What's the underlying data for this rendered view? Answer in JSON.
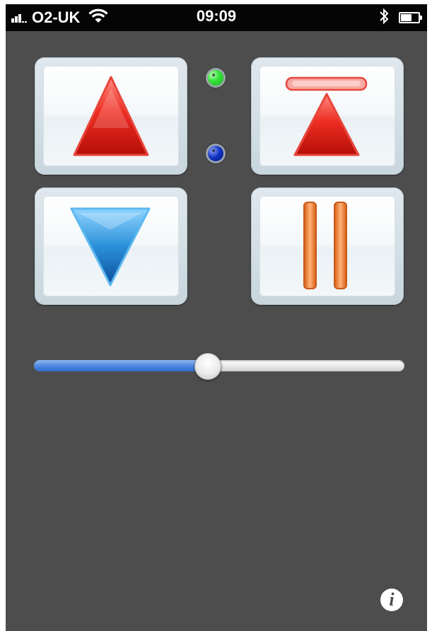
{
  "status_bar": {
    "carrier": "O2-UK",
    "time": "09:09",
    "signal_bars": 5,
    "signal_strength": 3,
    "battery_level": 0.7,
    "icons": [
      "signal-icon",
      "wifi-icon",
      "bluetooth-icon",
      "battery-icon"
    ]
  },
  "controls": {
    "buttons": [
      {
        "name": "up",
        "icon": "up-arrow-icon",
        "color": "#d9261c"
      },
      {
        "name": "up-to-top",
        "icon": "up-to-top-icon",
        "color": "#d9261c"
      },
      {
        "name": "down",
        "icon": "down-arrow-icon",
        "color": "#2a8fd8"
      },
      {
        "name": "pause",
        "icon": "pause-icon",
        "color": "#e57a2a"
      }
    ],
    "indicators": [
      {
        "name": "status-green",
        "color": "#34e23a"
      },
      {
        "name": "status-blue",
        "color": "#1030c0"
      }
    ]
  },
  "slider": {
    "value_fraction": 0.47,
    "fill_color": "#4b86df"
  },
  "info_button": {
    "label": "i",
    "icon": "info-icon"
  },
  "colors": {
    "background": "#4d4d4d",
    "status_bar": "#050505"
  }
}
